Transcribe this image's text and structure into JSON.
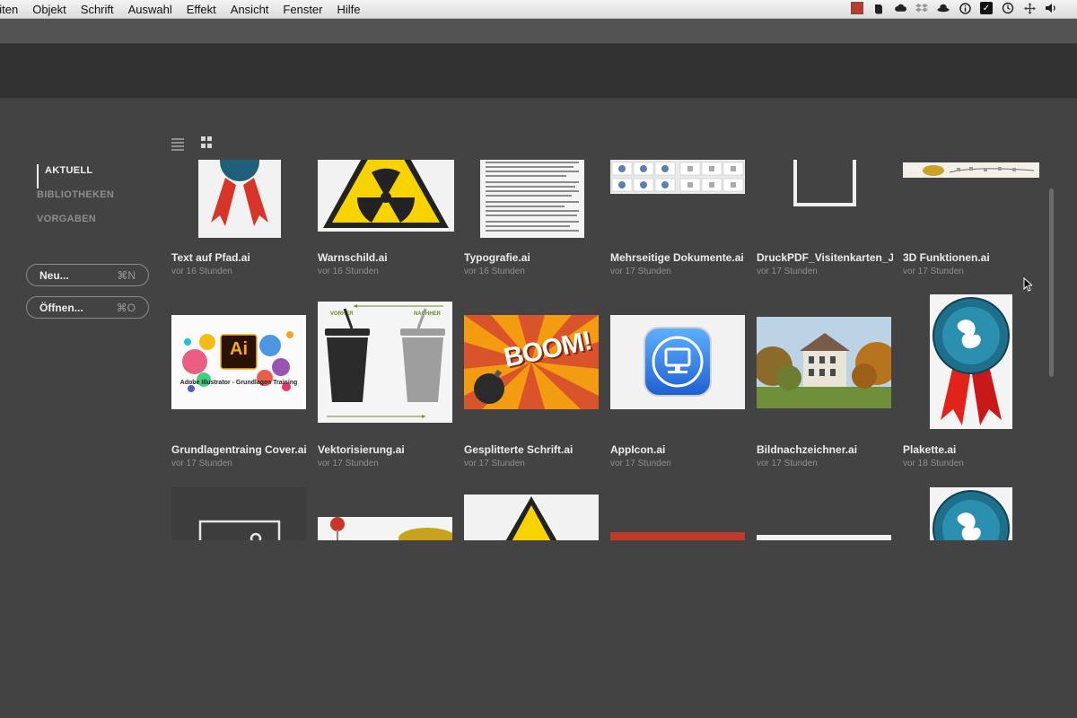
{
  "menubar": {
    "items": [
      "eiten",
      "Objekt",
      "Schrift",
      "Auswahl",
      "Effekt",
      "Ansicht",
      "Fenster",
      "Hilfe"
    ],
    "tray_icons": [
      "red-square-icon",
      "evernote-icon",
      "cloud-icon",
      "dropbox-icon",
      "hat-icon",
      "info-icon",
      "checkbox-icon",
      "time-machine-icon",
      "move-icon",
      "volume-icon"
    ]
  },
  "nav": {
    "items": [
      {
        "label": "AKTUELL",
        "active": true
      },
      {
        "label": "BIBLIOTHEKEN",
        "active": false
      },
      {
        "label": "VORGABEN",
        "active": false
      }
    ]
  },
  "buttons": {
    "new_label": "Neu...",
    "new_shortcut": "⌘N",
    "open_label": "Öffnen...",
    "open_shortcut": "⌘O"
  },
  "files": [
    {
      "name": "Text auf Pfad.ai",
      "time": "vor 16 Stunden",
      "thumb": "ribbon"
    },
    {
      "name": "Warnschild.ai",
      "time": "vor 16 Stunden",
      "thumb": "radiation"
    },
    {
      "name": "Typografie.ai",
      "time": "vor 16 Stunden",
      "thumb": "text"
    },
    {
      "name": "Mehrseitige Dokumente.ai",
      "time": "vor 17 Stunden",
      "thumb": "pages"
    },
    {
      "name": "DruckPDF_Visitenkarten_JR...",
      "time": "vor 17 Stunden",
      "thumb": "frame"
    },
    {
      "name": "3D Funktionen.ai",
      "time": "vor 17 Stunden",
      "thumb": "strip"
    },
    {
      "name": "Grundlagentraing Cover.ai",
      "time": "vor 17 Stunden",
      "thumb": "aicover"
    },
    {
      "name": "Vektorisierung.ai",
      "time": "vor 17 Stunden",
      "thumb": "cups"
    },
    {
      "name": "Gesplitterte Schrift.ai",
      "time": "vor 17 Stunden",
      "thumb": "boom"
    },
    {
      "name": "AppIcon.ai",
      "time": "vor 17 Stunden",
      "thumb": "appicon"
    },
    {
      "name": "Bildnachzeichner.ai",
      "time": "vor 17 Stunden",
      "thumb": "photo"
    },
    {
      "name": "Plakette.ai",
      "time": "vor 18 Stunden",
      "thumb": "badge"
    }
  ],
  "thumb_text": {
    "ai_logo": "Ai",
    "ai_caption": "Adobe Illustrator - Grundlagen Training",
    "vorher": "VORHER",
    "nachher": "NACHHER",
    "boom": "BOOM!"
  }
}
